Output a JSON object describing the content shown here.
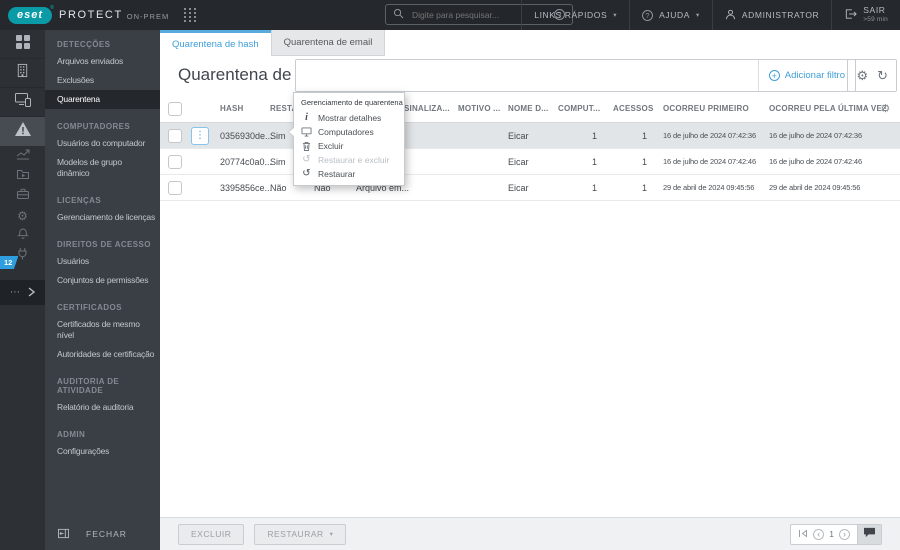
{
  "icons": {
    "gear": "⚙",
    "refresh": "↻",
    "dots_vertical": "⋮",
    "dots_horizontal": "⋯",
    "caret_down": "▾",
    "chevron_left": "‹",
    "chevron_right": "›",
    "question": "?",
    "plus": "+",
    "info": "i",
    "restore": "↺"
  },
  "topbar": {
    "brand": {
      "logo": "eset",
      "reg": "®",
      "product": "PROTECT",
      "edition": "ON-PREM"
    },
    "search_placeholder": "Digite para pesquisar...",
    "quick_links": "LINKS RÁPIDOS",
    "help": "AJUDA",
    "user": "ADMINISTRATOR",
    "logout": "SAIR",
    "logout_timer": ">59 min"
  },
  "rail": {
    "badge": "12"
  },
  "sidebar": {
    "sections": [
      {
        "title": "DETECÇÕES",
        "items": [
          {
            "label": "Arquivos enviados"
          },
          {
            "label": "Exclusões"
          },
          {
            "label": "Quarentena"
          }
        ]
      },
      {
        "title": "COMPUTADORES",
        "items": [
          {
            "label": "Usuários do computador"
          },
          {
            "label": "Modelos de grupo\ndinâmico"
          }
        ]
      },
      {
        "title": "LICENÇAS",
        "items": [
          {
            "label": "Gerenciamento de licenças"
          }
        ]
      },
      {
        "title": "DIREITOS DE ACESSO",
        "items": [
          {
            "label": "Usuários"
          },
          {
            "label": "Conjuntos de permissões"
          }
        ]
      },
      {
        "title": "CERTIFICADOS",
        "items": [
          {
            "label": "Certificados de mesmo\nnível"
          },
          {
            "label": "Autoridades de certificação"
          }
        ]
      },
      {
        "title": "AUDITORIA DE\nATIVIDADE",
        "items": [
          {
            "label": "Relatório de auditoria"
          }
        ]
      },
      {
        "title": "ADMIN",
        "items": [
          {
            "label": "Configurações"
          }
        ]
      }
    ],
    "close": "FECHAR"
  },
  "tabs": {
    "hash": "Quarentena de hash",
    "email": "Quarentena de email"
  },
  "page": {
    "title": "Quarentena de hash",
    "add_filter": "Adicionar filtro"
  },
  "table": {
    "headers": {
      "hash": "HASH",
      "restaurado": "RESTAU...",
      "sinalizado": "SINALIZA...",
      "motivo": "MOTIVO ...",
      "nome": "NOME D...",
      "computadores": "COMPUT...",
      "acessos": "ACESSOS",
      "primeiro": "OCORREU PRIMEIRO",
      "ultima": "OCORREU PELA ÚLTIMA VEZ"
    },
    "rows": [
      {
        "hash": "0356930de...",
        "restaurado": "Sim",
        "hidden1": "",
        "hidden2": "",
        "sinalizado": "",
        "motivo": "",
        "nome": "Eicar",
        "computadores": "1",
        "acessos": "1",
        "primeiro": "16 de julho de 2024 07:42:36",
        "ultima": "16 de julho de 2024 07:42:36"
      },
      {
        "hash": "20774c0a0...",
        "restaurado": "Sim",
        "hidden1": "",
        "hidden2": "",
        "sinalizado": "",
        "motivo": "",
        "nome": "Eicar",
        "computadores": "1",
        "acessos": "1",
        "primeiro": "16 de julho de 2024 07:42:46",
        "ultima": "16 de julho de 2024 07:42:46"
      },
      {
        "hash": "3395856ce...",
        "restaurado": "Não",
        "hidden1": "Não",
        "hidden2": "Arquivo em...",
        "sinalizado": "",
        "motivo": "",
        "nome": "Eicar",
        "computadores": "1",
        "acessos": "1",
        "primeiro": "29 de abril de 2024 09:45:56",
        "ultima": "29 de abril de 2024 09:45:56"
      }
    ]
  },
  "context_menu": {
    "title": "Gerenciamento de quarentena",
    "items": [
      {
        "label": "Mostrar detalhes"
      },
      {
        "label": "Computadores"
      },
      {
        "label": "Excluir"
      },
      {
        "label": "Restaurar e excluir"
      },
      {
        "label": "Restaurar"
      }
    ]
  },
  "footer": {
    "excluir": "EXCLUIR",
    "restaurar": "RESTAURAR",
    "page": "1"
  },
  "colors": {
    "accent_blue": "#3f9ed8",
    "brand_teal": "#0a9ba7",
    "badge_blue": "#2e9edf",
    "topbar_bg": "#25292e"
  }
}
